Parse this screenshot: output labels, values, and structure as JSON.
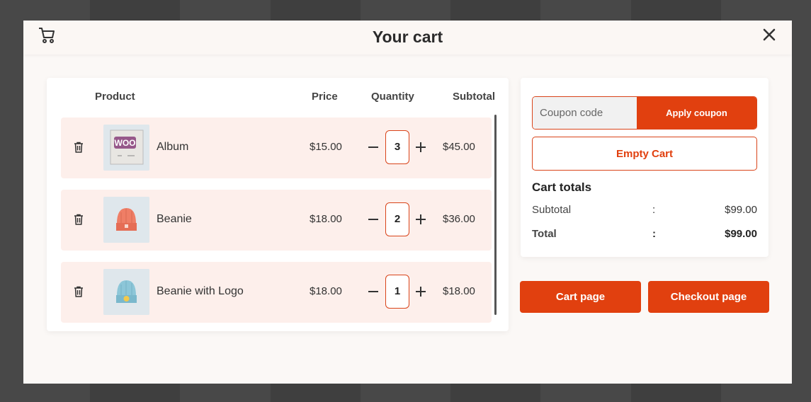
{
  "modal": {
    "title": "Your cart",
    "icons": {
      "cart": "cart-icon",
      "close": "close-icon"
    }
  },
  "table": {
    "headers": {
      "product": "Product",
      "price": "Price",
      "quantity": "Quantity",
      "subtotal": "Subtotal"
    },
    "rows": [
      {
        "name": "Album",
        "price": "$15.00",
        "quantity": "3",
        "subtotal": "$45.00",
        "thumb": "album-thumbnail"
      },
      {
        "name": "Beanie",
        "price": "$18.00",
        "quantity": "2",
        "subtotal": "$36.00",
        "thumb": "beanie-thumbnail"
      },
      {
        "name": "Beanie with Logo",
        "price": "$18.00",
        "quantity": "1",
        "subtotal": "$18.00",
        "thumb": "beanie-logo-thumbnail"
      }
    ]
  },
  "coupon": {
    "placeholder": "Coupon code",
    "apply_label": "Apply coupon"
  },
  "empty_cart_label": "Empty Cart",
  "totals": {
    "title": "Cart totals",
    "subtotal_label": "Subtotal",
    "subtotal_value": "$99.00",
    "total_label": "Total",
    "total_value": "$99.00",
    "separator": ":"
  },
  "actions": {
    "cart_page": "Cart page",
    "checkout_page": "Checkout page"
  },
  "colors": {
    "accent": "#e1400f",
    "row_bg": "#fdefeb",
    "modal_bg": "#fbf8f6"
  }
}
